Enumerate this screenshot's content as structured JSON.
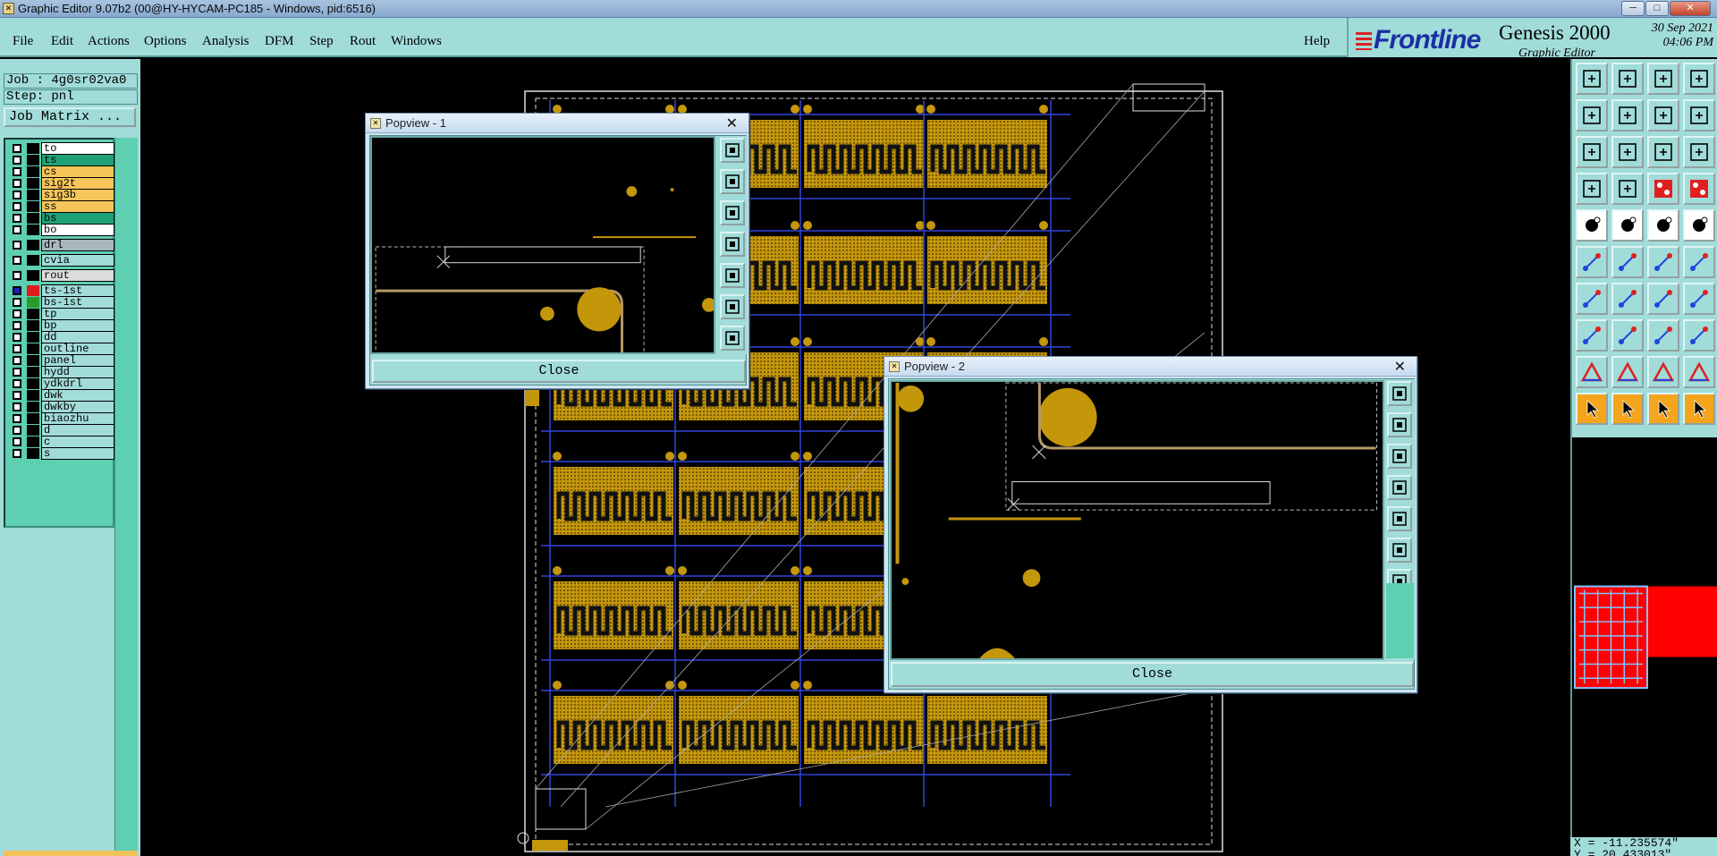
{
  "window": {
    "title": "Graphic Editor 9.07b2 (00@HY-HYCAM-PC185 - Windows, pid:6516)",
    "icon": "app-icon",
    "min_label": "─",
    "max_label": "□",
    "close_label": "✕"
  },
  "menu": {
    "items": [
      {
        "label": "File"
      },
      {
        "label": "Edit"
      },
      {
        "label": "Actions"
      },
      {
        "label": "Options"
      },
      {
        "label": "Analysis"
      },
      {
        "label": "DFM"
      },
      {
        "label": "Step"
      },
      {
        "label": "Rout"
      },
      {
        "label": "Windows"
      }
    ],
    "help": "Help"
  },
  "brand": {
    "logo": "Frontline",
    "product": "Genesis 2000",
    "subtitle": "Graphic Editor",
    "date": "30 Sep 2021",
    "time": "04:06 PM"
  },
  "job": {
    "job_label": "Job : 4g0sr02va0",
    "step_label": "Step: pnl",
    "matrix_button": "Job Matrix ..."
  },
  "layers": [
    {
      "name": "to",
      "color": "#ffffff",
      "checked": false
    },
    {
      "name": "ts",
      "color": "#1fa277",
      "checked": false
    },
    {
      "name": "cs",
      "color": "#f7c65a",
      "checked": false
    },
    {
      "name": "sig2t",
      "color": "#f7c65a",
      "checked": false
    },
    {
      "name": "sig3b",
      "color": "#f7c65a",
      "checked": false
    },
    {
      "name": "ss",
      "color": "#f7c65a",
      "checked": false
    },
    {
      "name": "bs",
      "color": "#1fa277",
      "checked": false
    },
    {
      "name": "bo",
      "color": "#ffffff",
      "checked": false
    },
    {
      "name": "drl",
      "color": "#a8b6bd",
      "checked": false
    },
    {
      "name": "cvia",
      "color": "#a1dcd9",
      "checked": false
    },
    {
      "name": "rout",
      "color": "#dcdcdc",
      "checked": false
    },
    {
      "name": "ts-1st",
      "color": "#a1dcd9",
      "checked": true,
      "swatch": "#e01b1b"
    },
    {
      "name": "bs-1st",
      "color": "#a1dcd9",
      "checked": false,
      "swatch": "#2b9a2b"
    },
    {
      "name": "tp",
      "color": "#a1dcd9",
      "checked": false
    },
    {
      "name": "bp",
      "color": "#a1dcd9",
      "checked": false
    },
    {
      "name": "dd",
      "color": "#a1dcd9",
      "checked": false
    },
    {
      "name": "outline",
      "color": "#a1dcd9",
      "checked": false
    },
    {
      "name": "panel",
      "color": "#a1dcd9",
      "checked": false
    },
    {
      "name": "hydd",
      "color": "#a1dcd9",
      "checked": false
    },
    {
      "name": "ydkdrl",
      "color": "#a1dcd9",
      "checked": false
    },
    {
      "name": "dwk",
      "color": "#a1dcd9",
      "checked": false
    },
    {
      "name": "dwkby",
      "color": "#a1dcd9",
      "checked": false
    },
    {
      "name": "biaozhu",
      "color": "#a1dcd9",
      "checked": false
    },
    {
      "name": "d",
      "color": "#a1dcd9",
      "checked": false
    },
    {
      "name": "c",
      "color": "#a1dcd9",
      "checked": false
    },
    {
      "name": "s",
      "color": "#a1dcd9",
      "checked": false
    }
  ],
  "popview1": {
    "title": "Popview - 1",
    "close_label": "Close"
  },
  "popview2": {
    "title": "Popview - 2",
    "close_label": "Close"
  },
  "colors": {
    "copper": "#c4960a",
    "panel_bg": "#a1dcd9",
    "layer_green": "#5ecfb1"
  },
  "status": {
    "x_coord": "X = -11.235574\"",
    "y_coord": "Y = 20.433013\""
  }
}
